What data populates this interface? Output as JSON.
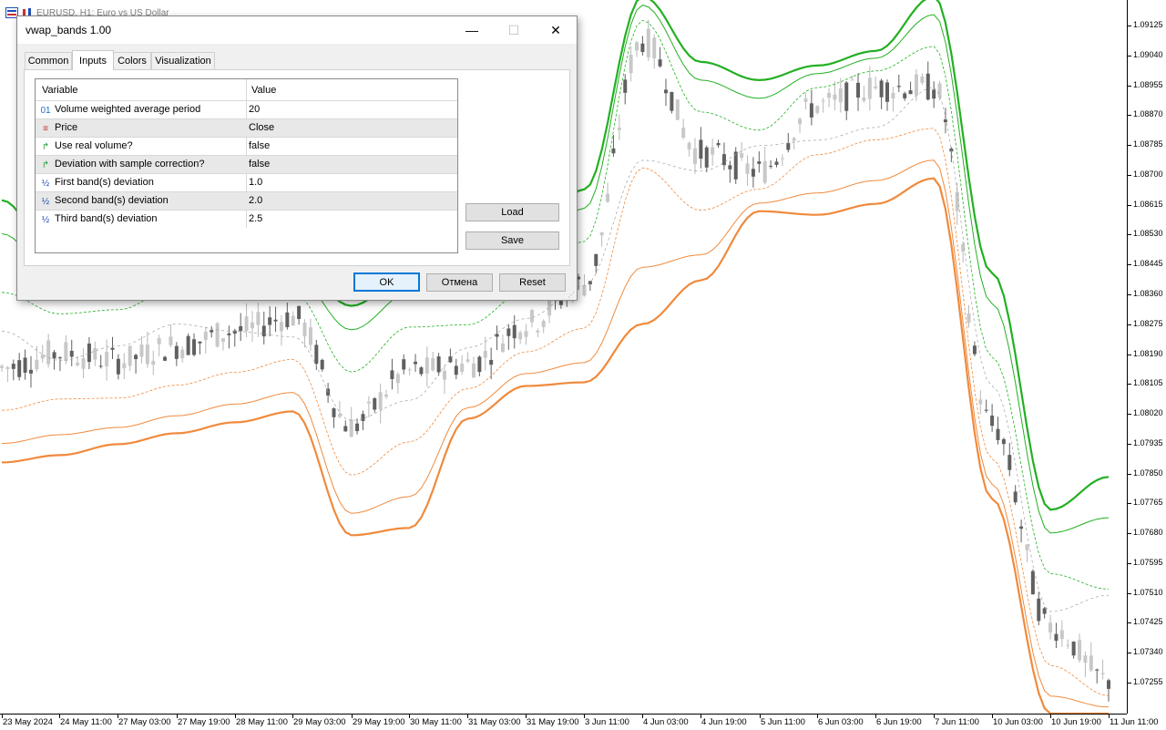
{
  "chart_window": {
    "symbol_title": "EURUSD, H1:  Euro vs US Dollar",
    "price_axis": [
      "1.09125",
      "1.09040",
      "1.08955",
      "1.08870",
      "1.08785",
      "1.08700",
      "1.08615",
      "1.08530",
      "1.08445",
      "1.08360",
      "1.08275",
      "1.08190",
      "1.08105",
      "1.08020",
      "1.07935",
      "1.07850",
      "1.07765",
      "1.07680",
      "1.07595",
      "1.07510",
      "1.07425",
      "1.07340",
      "1.07255"
    ],
    "time_axis": [
      "23 May 2024",
      "24 May 11:00",
      "27 May 03:00",
      "27 May 19:00",
      "28 May 11:00",
      "29 May 03:00",
      "29 May 19:00",
      "30 May 11:00",
      "31 May 03:00",
      "31 May 19:00",
      "3 Jun 11:00",
      "4 Jun 03:00",
      "4 Jun 19:00",
      "5 Jun 11:00",
      "6 Jun 03:00",
      "6 Jun 19:00",
      "7 Jun 11:00",
      "10 Jun 03:00",
      "10 Jun 19:00",
      "11 Jun 11:00"
    ],
    "colors": {
      "upper_bands": "#22b022",
      "lower_bands": "#f08a3c",
      "vwap_line": "#a0a0a0",
      "candles": "#606060"
    }
  },
  "chart_data": {
    "type": "line",
    "title": "EURUSD, H1:  Euro vs US Dollar",
    "x": [
      "23 May 2024",
      "24 May 11:00",
      "27 May 03:00",
      "27 May 19:00",
      "28 May 11:00",
      "29 May 03:00",
      "29 May 19:00",
      "30 May 11:00",
      "31 May 03:00",
      "31 May 19:00",
      "3 Jun 11:00",
      "4 Jun 03:00",
      "4 Jun 19:00",
      "5 Jun 11:00",
      "6 Jun 03:00",
      "6 Jun 19:00",
      "7 Jun 11:00",
      "10 Jun 03:00",
      "10 Jun 19:00",
      "11 Jun 11:00"
    ],
    "ylim": [
      1.0721,
      1.0917
    ],
    "series": [
      {
        "role": "third_upper",
        "values": [
          1.0862,
          1.0844,
          1.0849,
          1.0858,
          1.0851,
          1.0845,
          1.0833,
          1.0842,
          1.0841,
          1.0848,
          1.0865,
          1.0918,
          1.09,
          1.0895,
          1.0899,
          1.0903,
          1.0918,
          1.0842,
          1.0777,
          1.0786
        ]
      },
      {
        "role": "price",
        "values": [
          1.0816,
          1.082,
          1.0818,
          1.0822,
          1.0826,
          1.083,
          1.08,
          1.0815,
          1.0817,
          1.0828,
          1.0839,
          1.0906,
          1.0875,
          1.087,
          1.0888,
          1.0893,
          1.0893,
          1.08,
          1.0745,
          1.073
        ]
      },
      {
        "role": "third_lower",
        "values": [
          1.079,
          1.0792,
          1.0795,
          1.0798,
          1.0801,
          1.0804,
          1.077,
          1.0772,
          1.0802,
          1.0811,
          1.0812,
          1.0828,
          1.084,
          1.0859,
          1.0858,
          1.0861,
          1.0868,
          1.078,
          1.0721,
          1.0721
        ]
      }
    ]
  },
  "dialog": {
    "title": "vwap_bands 1.00",
    "window_controls": {
      "minimize": "—",
      "maximize": "☐",
      "close": "✕"
    },
    "tabs": [
      "Common",
      "Inputs",
      "Colors",
      "Visualization"
    ],
    "active_tab": "Inputs",
    "table": {
      "headers": {
        "variable": "Variable",
        "value": "Value"
      },
      "rows": [
        {
          "icon": "integer-icon",
          "icon_glyph": "01",
          "name": "Volume weighted average period",
          "value": "20"
        },
        {
          "icon": "enum-icon",
          "icon_glyph": "≡",
          "name": "Price",
          "value": "Close"
        },
        {
          "icon": "bool-icon",
          "icon_glyph": "↱",
          "name": "Use real volume?",
          "value": "false"
        },
        {
          "icon": "bool-icon",
          "icon_glyph": "↱",
          "name": "Deviation with sample correction?",
          "value": "false"
        },
        {
          "icon": "double-icon",
          "icon_glyph": "½",
          "name": "First band(s) deviation",
          "value": "1.0"
        },
        {
          "icon": "double-icon",
          "icon_glyph": "½",
          "name": "Second band(s) deviation",
          "value": "2.0"
        },
        {
          "icon": "double-icon",
          "icon_glyph": "½",
          "name": "Third band(s) deviation",
          "value": "2.5"
        }
      ]
    },
    "buttons": {
      "load": "Load",
      "save": "Save",
      "ok": "OK",
      "cancel": "Отмена",
      "reset": "Reset"
    }
  }
}
